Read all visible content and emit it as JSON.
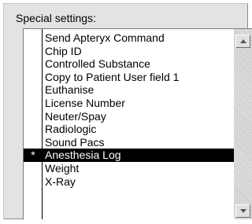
{
  "groupbox": {
    "label": "Special settings:"
  },
  "list": {
    "items": [
      {
        "label": "Send Apteryx Command",
        "marker": "",
        "selected": false
      },
      {
        "label": "Chip ID",
        "marker": "",
        "selected": false
      },
      {
        "label": "Controlled Substance",
        "marker": "",
        "selected": false
      },
      {
        "label": "Copy to Patient User field 1",
        "marker": "",
        "selected": false
      },
      {
        "label": "Euthanise",
        "marker": "",
        "selected": false
      },
      {
        "label": "License Number",
        "marker": "",
        "selected": false
      },
      {
        "label": "Neuter/Spay",
        "marker": "",
        "selected": false
      },
      {
        "label": "Radiologic",
        "marker": "",
        "selected": false
      },
      {
        "label": "Sound Pacs",
        "marker": "",
        "selected": false
      },
      {
        "label": "Anesthesia Log",
        "marker": "*",
        "selected": true
      },
      {
        "label": "Weight",
        "marker": "",
        "selected": false
      },
      {
        "label": "X-Ray",
        "marker": "",
        "selected": false
      }
    ]
  },
  "scrollbar": {
    "up_icon": "arrow-up-icon",
    "down_icon": "arrow-down-icon"
  },
  "colors": {
    "selection_background": "#000000",
    "selection_text": "#ffffff",
    "panel_background": "#e3e3e3"
  }
}
